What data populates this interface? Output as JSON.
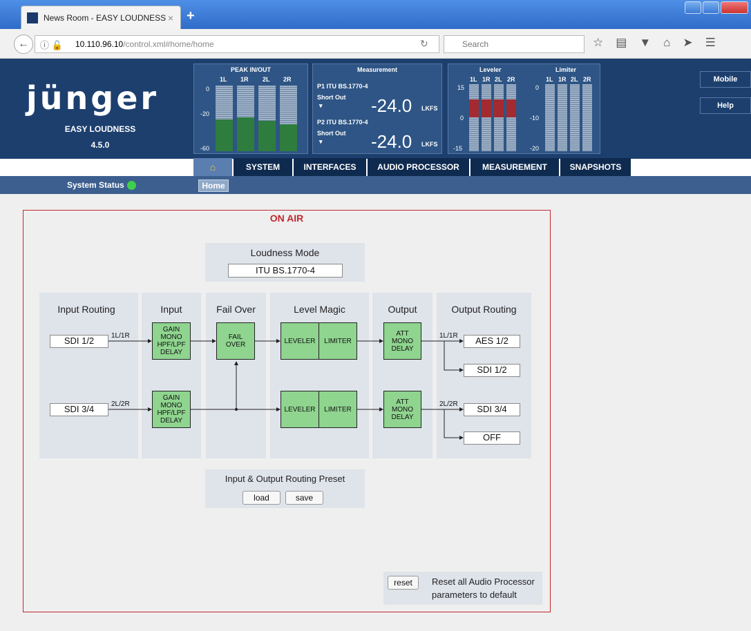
{
  "browser": {
    "tab_title": "News Room - EASY LOUDNESS",
    "tab_close": "×",
    "new_tab": "+",
    "url_host": "10.110.96.10",
    "url_path": "/control.xml#home/home",
    "search_placeholder": "Search",
    "icons": [
      "back-arrow-icon",
      "info-icon",
      "insecure-lock-icon",
      "reload-icon",
      "search-icon",
      "star-icon",
      "reading-list-icon",
      "pocket-icon",
      "home-icon",
      "send-icon",
      "menu-icon"
    ]
  },
  "header": {
    "logo": "jünger",
    "product": "EASY LOUDNESS",
    "version": "4.5.0",
    "room": "News Room",
    "peak": {
      "title": "PEAK IN/OUT",
      "channels": [
        "1L",
        "1R",
        "2L",
        "2R"
      ],
      "scale": [
        "0",
        "-20",
        "-60"
      ],
      "levels_fraction": [
        0.48,
        0.52,
        0.46,
        0.41
      ]
    },
    "measurement": {
      "title": "Measurement",
      "p1_label": "P1 ITU BS.1770-4",
      "p1_sub": "Short Out",
      "p1_value": "-24.0",
      "p2_label": "P2 ITU BS.1770-4",
      "p2_sub": "Short Out",
      "p2_value": "-24.0",
      "unit": "LKFS",
      "arrow": "▾"
    },
    "leveler": {
      "title": "Leveler",
      "channels": [
        "1L",
        "1R",
        "2L",
        "2R"
      ],
      "scale": [
        "15",
        "0",
        "-15"
      ]
    },
    "limiter": {
      "title": "Limiter",
      "channels": [
        "1L",
        "1R",
        "2L",
        "2R"
      ],
      "scale": [
        "0",
        "-10",
        "-20"
      ]
    },
    "mobile": "Mobile",
    "help": "Help"
  },
  "menu": [
    "SYSTEM",
    "INTERFACES",
    "AUDIO PROCESSOR",
    "MEASUREMENT",
    "SNAPSHOTS"
  ],
  "status": {
    "label": "System Status",
    "color": "#3ed04a"
  },
  "breadcrumb": "Home",
  "main": {
    "on_air": "ON AIR",
    "loudness_mode_title": "Loudness Mode",
    "loudness_mode_value": "ITU BS.1770-4",
    "columns": {
      "input_routing": "Input Routing",
      "input": "Input",
      "fail_over": "Fail Over",
      "level_magic": "Level Magic",
      "output": "Output",
      "output_routing": "Output Routing"
    },
    "in1": "SDI 1/2",
    "in2": "SDI 3/4",
    "sig1": "1L/1R",
    "sig2": "2L/2R",
    "input_box_1": [
      "GAIN",
      "MONO",
      "HPF/LPF",
      "DELAY"
    ],
    "input_box_2": [
      "GAIN",
      "MONO",
      "HPF/LPF",
      "DELAY"
    ],
    "failover": [
      "FAIL",
      "OVER"
    ],
    "leveler": "LEVELER",
    "limiter": "LIMITER",
    "output_box_1": [
      "ATT",
      "MONO",
      "DELAY"
    ],
    "output_box_2": [
      "ATT",
      "MONO",
      "DELAY"
    ],
    "out_sig1": "1L/1R",
    "out_sig2": "2L/2R",
    "out1": "AES 1/2",
    "out2": "SDI 1/2",
    "out3": "SDI 3/4",
    "out4": "OFF",
    "preset_title": "Input & Output Routing Preset",
    "load": "load",
    "save": "save",
    "reset": "reset",
    "reset_text_1": "Reset all Audio Processor",
    "reset_text_2": "parameters to default"
  }
}
